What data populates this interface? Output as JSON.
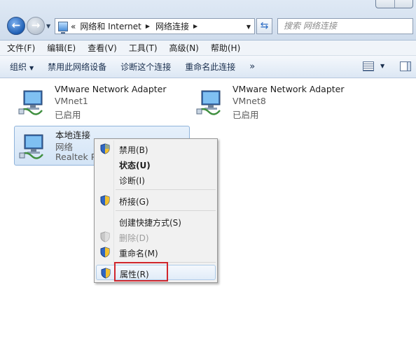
{
  "address": {
    "overflow": "«",
    "crumbs": [
      "网络和 Internet",
      "网络连接"
    ],
    "refresh_icon": "refresh-icon"
  },
  "search": {
    "placeholder": "搜索 网络连接"
  },
  "menubar": [
    "文件(F)",
    "编辑(E)",
    "查看(V)",
    "工具(T)",
    "高级(N)",
    "帮助(H)"
  ],
  "commandbar": {
    "organize": "组织",
    "disable": "禁用此网络设备",
    "diagnose": "诊断这个连接",
    "rename": "重命名此连接",
    "more": "»"
  },
  "connections": [
    {
      "name": "VMware Network Adapter",
      "network": "VMnet1",
      "status": "已启用"
    },
    {
      "name": "VMware Network Adapter",
      "network": "VMnet8",
      "status": "已启用"
    },
    {
      "name": "本地连接",
      "network": "网络",
      "device": "Realtek P"
    }
  ],
  "context_menu": {
    "disable": "禁用(B)",
    "status": "状态(U)",
    "diagnose": "诊断(I)",
    "bridge": "桥接(G)",
    "shortcut": "创建快捷方式(S)",
    "delete": "删除(D)",
    "rename": "重命名(M)",
    "properties": "属性(R)"
  },
  "colors": {
    "highlight_box": "#d0262c",
    "selection": "#d3e4f6"
  }
}
